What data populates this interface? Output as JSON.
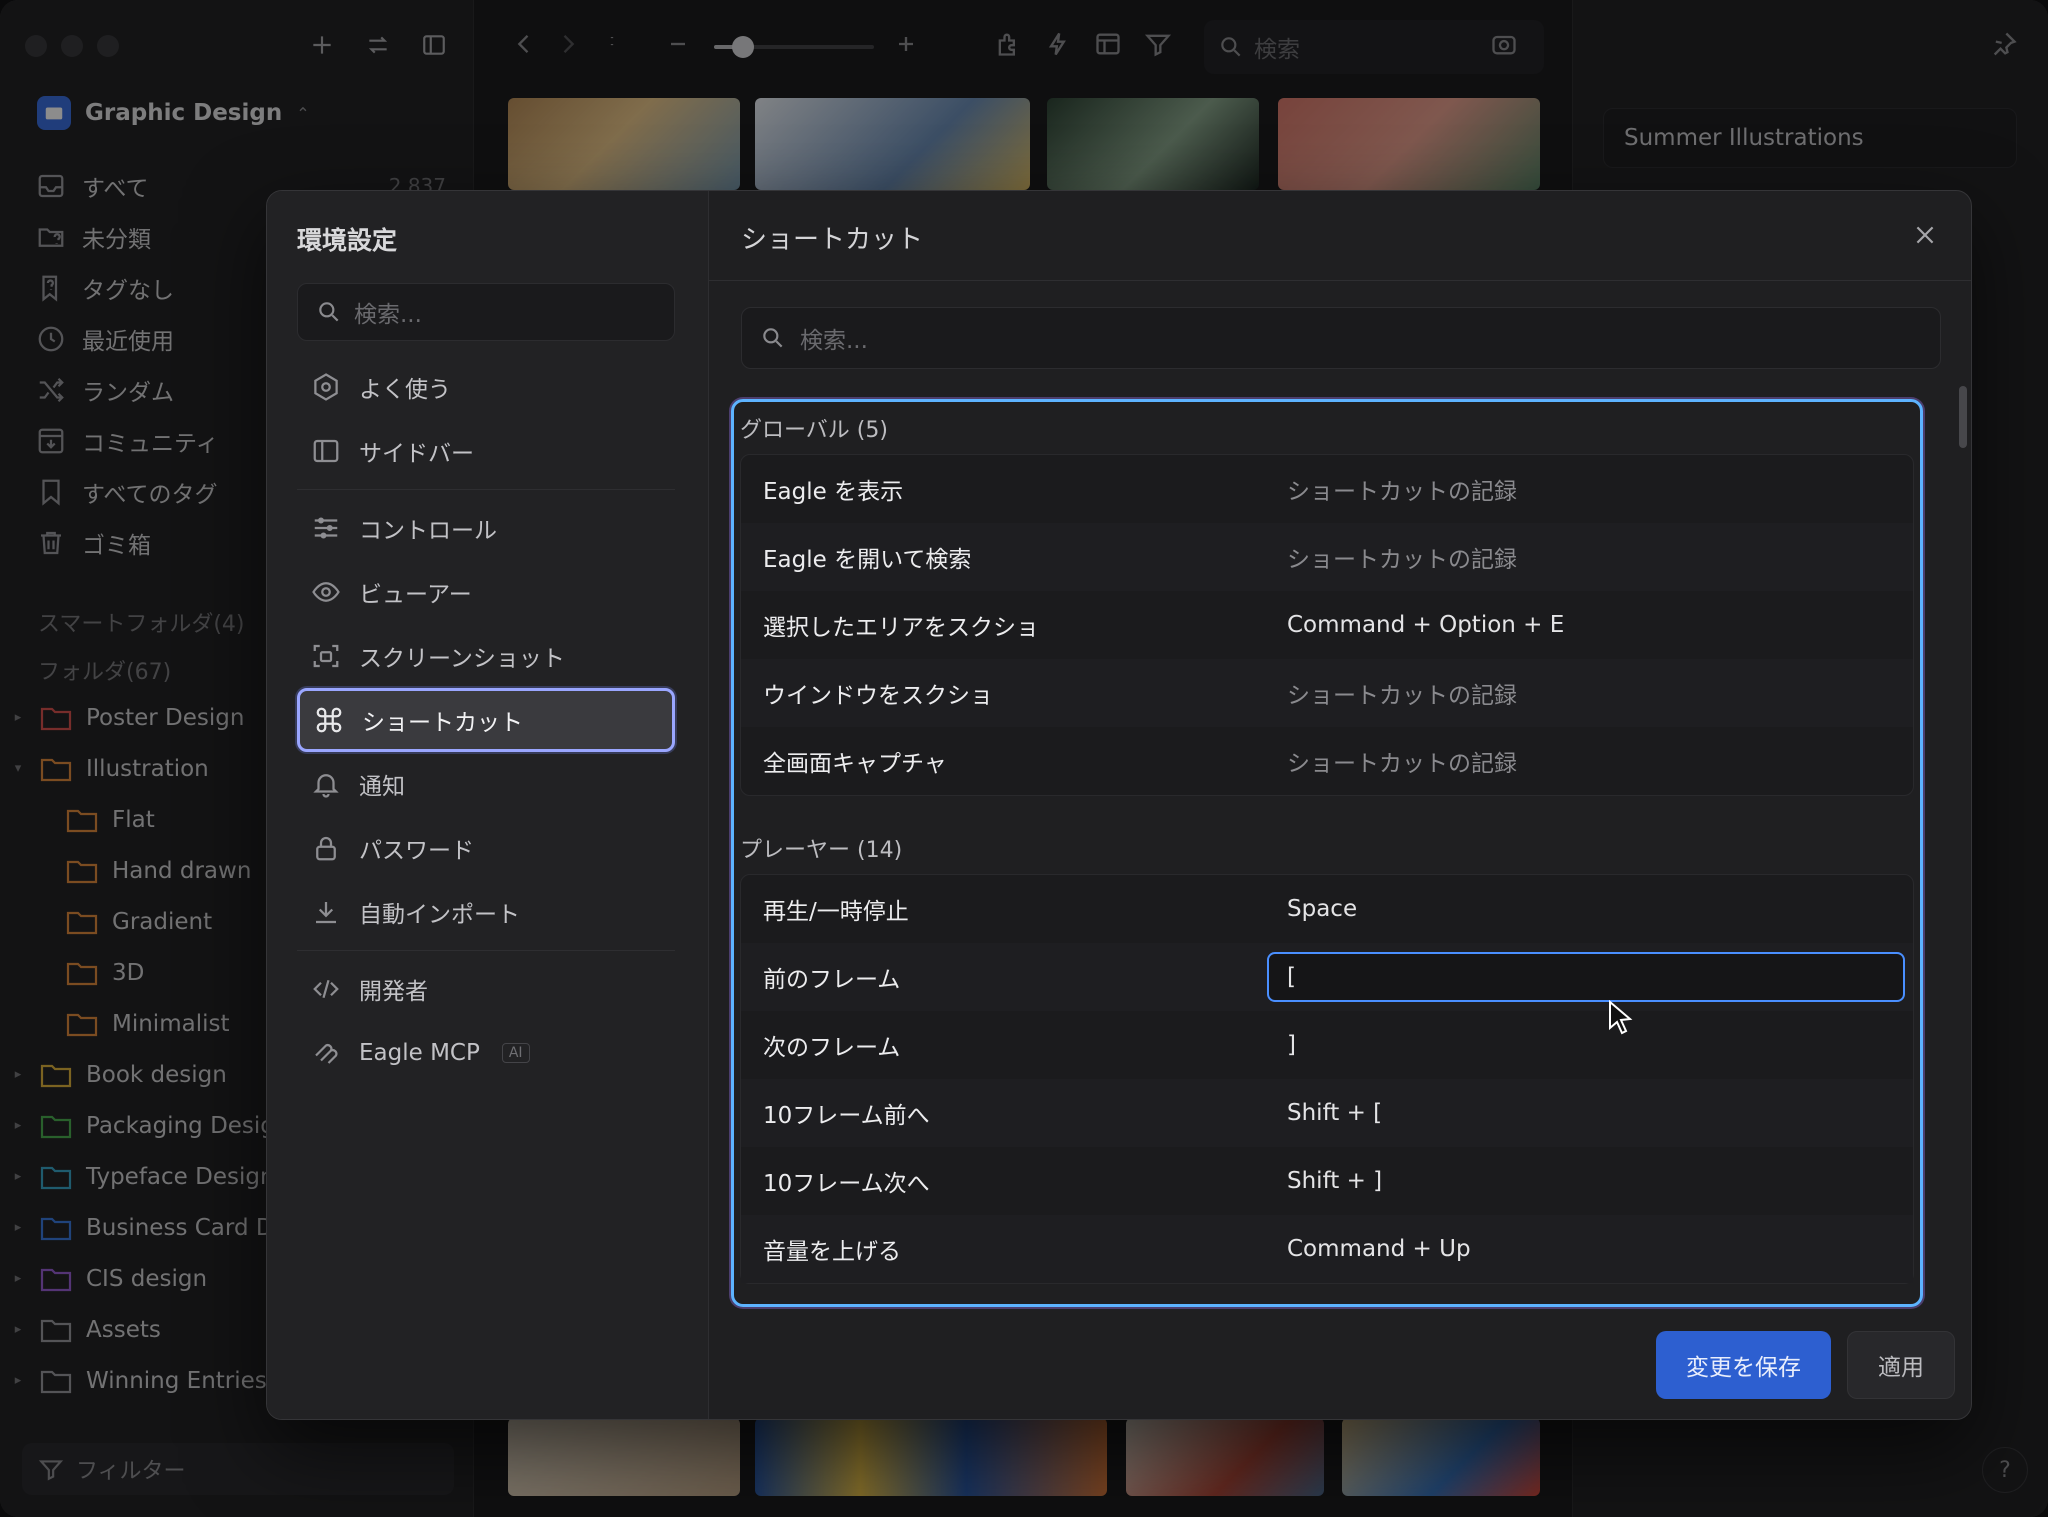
{
  "sidebar": {
    "library_name": "Graphic Design",
    "nav": [
      {
        "label": "すべて",
        "count": "2,837",
        "icon": "inbox-icon"
      },
      {
        "label": "未分類",
        "count": "",
        "icon": "folder-question-icon"
      },
      {
        "label": "タグなし",
        "count": "",
        "icon": "tag-question-icon"
      },
      {
        "label": "最近使用",
        "count": "",
        "icon": "clock-icon"
      },
      {
        "label": "ランダム",
        "count": "",
        "icon": "shuffle-icon"
      },
      {
        "label": "コミュニティ",
        "count": "",
        "icon": "download-box-icon"
      },
      {
        "label": "すべてのタグ",
        "count": "",
        "icon": "bookmark-icon"
      },
      {
        "label": "ゴミ箱",
        "count": "",
        "icon": "trash-icon"
      }
    ],
    "smart_folders_label": "スマートフォルダ(4)",
    "folders_label": "フォルダ(67)",
    "folders": [
      {
        "label": "Poster Design",
        "color": "#d9534f",
        "level": 0,
        "arrow": "▸"
      },
      {
        "label": "Illustration",
        "color": "#e08a3c",
        "level": 0,
        "arrow": "▾"
      },
      {
        "label": "Flat",
        "color": "#e08a3c",
        "level": 1,
        "arrow": ""
      },
      {
        "label": "Hand drawn",
        "color": "#e08a3c",
        "level": 1,
        "arrow": ""
      },
      {
        "label": "Gradient",
        "color": "#e08a3c",
        "level": 1,
        "arrow": ""
      },
      {
        "label": "3D",
        "color": "#e08a3c",
        "level": 1,
        "arrow": ""
      },
      {
        "label": "Minimalist",
        "color": "#e08a3c",
        "level": 1,
        "arrow": ""
      },
      {
        "label": "Book design",
        "color": "#e0b43c",
        "level": 0,
        "arrow": "▸"
      },
      {
        "label": "Packaging Desig",
        "color": "#4caf50",
        "level": 0,
        "arrow": "▸"
      },
      {
        "label": "Typeface Design",
        "color": "#3aa6c9",
        "level": 0,
        "arrow": "▸"
      },
      {
        "label": "Business Card D",
        "color": "#3b7be0",
        "level": 0,
        "arrow": "▸"
      },
      {
        "label": "CIS design",
        "color": "#9a5fd6",
        "level": 0,
        "arrow": "▸"
      },
      {
        "label": "Assets",
        "color": "#9a9a9e",
        "level": 0,
        "arrow": "▸"
      },
      {
        "label": "Winning Entries",
        "color": "#9a9a9e",
        "level": 0,
        "arrow": "▸"
      }
    ],
    "filter_label": "フィルター"
  },
  "toolbar": {
    "search_placeholder": "検索",
    "zoom_level": 0.18
  },
  "right_panel": {
    "title": "Summer Illustrations",
    "help": "?"
  },
  "preferences": {
    "title": "環境設定",
    "search_placeholder": "検索...",
    "items": [
      {
        "label": "よく使う",
        "icon": "hexagon-gear-icon"
      },
      {
        "label": "サイドバー",
        "icon": "sidebar-icon"
      },
      {
        "label": "コントロール",
        "icon": "sliders-icon"
      },
      {
        "label": "ビューアー",
        "icon": "eye-icon"
      },
      {
        "label": "スクリーンショット",
        "icon": "screenshot-icon"
      },
      {
        "label": "ショートカット",
        "icon": "command-icon"
      },
      {
        "label": "通知",
        "icon": "bell-icon"
      },
      {
        "label": "パスワード",
        "icon": "lock-icon"
      },
      {
        "label": "自動インポート",
        "icon": "download-icon"
      },
      {
        "label": "開発者",
        "icon": "code-icon"
      },
      {
        "label": "Eagle MCP",
        "icon": "mcp-icon",
        "badge": "AI"
      }
    ]
  },
  "shortcuts": {
    "title": "ショートカット",
    "search_placeholder": "検索...",
    "groups": [
      {
        "title": "グローバル (5)",
        "rows": [
          {
            "label": "Eagle を表示",
            "value": "ショートカットの記録",
            "placeholder": true
          },
          {
            "label": "Eagle を開いて検索",
            "value": "ショートカットの記録",
            "placeholder": true
          },
          {
            "label": "選択したエリアをスクショ",
            "value": "Command + Option + E",
            "placeholder": false
          },
          {
            "label": "ウインドウをスクショ",
            "value": "ショートカットの記録",
            "placeholder": true
          },
          {
            "label": "全画面キャプチャ",
            "value": "ショートカットの記録",
            "placeholder": true
          }
        ]
      },
      {
        "title": "プレーヤー (14)",
        "rows": [
          {
            "label": "再生/一時停止",
            "value": "Space",
            "placeholder": false
          },
          {
            "label": "前のフレーム",
            "value": "[",
            "placeholder": false,
            "editing": true
          },
          {
            "label": "次のフレーム",
            "value": "]",
            "placeholder": false
          },
          {
            "label": "10フレーム前へ",
            "value": "Shift + [",
            "placeholder": false
          },
          {
            "label": "10フレーム次へ",
            "value": "Shift + ]",
            "placeholder": false
          },
          {
            "label": "音量を上げる",
            "value": "Command + Up",
            "placeholder": false
          }
        ]
      }
    ],
    "save_label": "変更を保存",
    "apply_label": "適用"
  }
}
